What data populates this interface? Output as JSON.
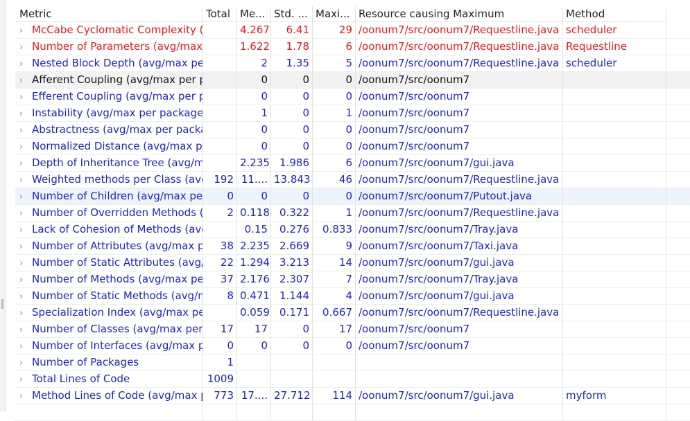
{
  "headers": [
    "Metric",
    "Total",
    "Me...",
    "Std. ...",
    "Maxi...",
    "Resource causing Maximum",
    "Method"
  ],
  "rows": [
    {
      "style": "red",
      "metric": "McCabe Cyclomatic Complexity (a",
      "total": "",
      "mean": "4.267",
      "std": "6.41",
      "max": "29",
      "resource": "/oonum7/src/oonum7/Requestline.java",
      "method": "scheduler"
    },
    {
      "style": "red",
      "metric": "Number of Parameters (avg/max p",
      "total": "",
      "mean": "1.622",
      "std": "1.78",
      "max": "6",
      "resource": "/oonum7/src/oonum7/Requestline.java",
      "method": "Requestline"
    },
    {
      "style": "blue",
      "metric": "Nested Block Depth (avg/max per",
      "total": "",
      "mean": "2",
      "std": "1.35",
      "max": "5",
      "resource": "/oonum7/src/oonum7/Requestline.java",
      "method": "scheduler"
    },
    {
      "style": "dark",
      "metric": "Afferent Coupling (avg/max per p",
      "total": "",
      "mean": "0",
      "std": "0",
      "max": "0",
      "resource": "/oonum7/src/oonum7",
      "method": ""
    },
    {
      "style": "blue",
      "metric": "Efferent Coupling (avg/max per pa",
      "total": "",
      "mean": "0",
      "std": "0",
      "max": "0",
      "resource": "/oonum7/src/oonum7",
      "method": ""
    },
    {
      "style": "blue",
      "metric": "Instability (avg/max per packageFi",
      "total": "",
      "mean": "1",
      "std": "0",
      "max": "1",
      "resource": "/oonum7/src/oonum7",
      "method": ""
    },
    {
      "style": "blue",
      "metric": "Abstractness (avg/max per packag",
      "total": "",
      "mean": "0",
      "std": "0",
      "max": "0",
      "resource": "/oonum7/src/oonum7",
      "method": ""
    },
    {
      "style": "blue",
      "metric": "Normalized Distance (avg/max pe",
      "total": "",
      "mean": "0",
      "std": "0",
      "max": "0",
      "resource": "/oonum7/src/oonum7",
      "method": ""
    },
    {
      "style": "blue",
      "metric": "Depth of Inheritance Tree (avg/ma",
      "total": "",
      "mean": "2.235",
      "std": "1.986",
      "max": "6",
      "resource": "/oonum7/src/oonum7/gui.java",
      "method": ""
    },
    {
      "style": "blue",
      "metric": "Weighted methods per Class (avg",
      "total": "192",
      "mean": "11....",
      "std": "13.843",
      "max": "46",
      "resource": "/oonum7/src/oonum7/Requestline.java",
      "method": ""
    },
    {
      "style": "blue",
      "metric": "Number of Children (avg/max per",
      "total": "0",
      "mean": "0",
      "std": "0",
      "max": "0",
      "resource": "/oonum7/src/oonum7/Putout.java",
      "method": ""
    },
    {
      "style": "blue",
      "metric": "Number of Overridden Methods (",
      "total": "2",
      "mean": "0.118",
      "std": "0.322",
      "max": "1",
      "resource": "/oonum7/src/oonum7/Requestline.java",
      "method": ""
    },
    {
      "style": "blue",
      "metric": "Lack of Cohesion of Methods (avg",
      "total": "",
      "mean": "0.15",
      "std": "0.276",
      "max": "0.833",
      "resource": "/oonum7/src/oonum7/Tray.java",
      "method": ""
    },
    {
      "style": "blue",
      "metric": "Number of Attributes (avg/max pe",
      "total": "38",
      "mean": "2.235",
      "std": "2.669",
      "max": "9",
      "resource": "/oonum7/src/oonum7/Taxi.java",
      "method": ""
    },
    {
      "style": "blue",
      "metric": "Number of Static Attributes (avg/",
      "total": "22",
      "mean": "1.294",
      "std": "3.213",
      "max": "14",
      "resource": "/oonum7/src/oonum7/gui.java",
      "method": ""
    },
    {
      "style": "blue",
      "metric": "Number of Methods (avg/max per",
      "total": "37",
      "mean": "2.176",
      "std": "2.307",
      "max": "7",
      "resource": "/oonum7/src/oonum7/Tray.java",
      "method": ""
    },
    {
      "style": "blue",
      "metric": "Number of Static Methods (avg/m",
      "total": "8",
      "mean": "0.471",
      "std": "1.144",
      "max": "4",
      "resource": "/oonum7/src/oonum7/gui.java",
      "method": ""
    },
    {
      "style": "blue",
      "metric": "Specialization Index (avg/max per",
      "total": "",
      "mean": "0.059",
      "std": "0.171",
      "max": "0.667",
      "resource": "/oonum7/src/oonum7/Requestline.java",
      "method": ""
    },
    {
      "style": "blue",
      "metric": "Number of Classes (avg/max per p",
      "total": "17",
      "mean": "17",
      "std": "0",
      "max": "17",
      "resource": "/oonum7/src/oonum7",
      "method": ""
    },
    {
      "style": "blue",
      "metric": "Number of Interfaces (avg/max pe",
      "total": "0",
      "mean": "0",
      "std": "0",
      "max": "0",
      "resource": "/oonum7/src/oonum7",
      "method": ""
    },
    {
      "style": "blue",
      "metric": "Number of Packages",
      "total": "1",
      "mean": "",
      "std": "",
      "max": "",
      "resource": "",
      "method": ""
    },
    {
      "style": "blue",
      "metric": "Total Lines of Code",
      "total": "1009",
      "mean": "",
      "std": "",
      "max": "",
      "resource": "",
      "method": ""
    },
    {
      "style": "blue",
      "metric": "Method Lines of Code (avg/max p",
      "total": "773",
      "mean": "17....",
      "std": "27.712",
      "max": "114",
      "resource": "/oonum7/src/oonum7/gui.java",
      "method": "myform"
    }
  ],
  "colors": {
    "red": "#e8171a",
    "blue": "#1d24c8",
    "dark": "#111111"
  }
}
